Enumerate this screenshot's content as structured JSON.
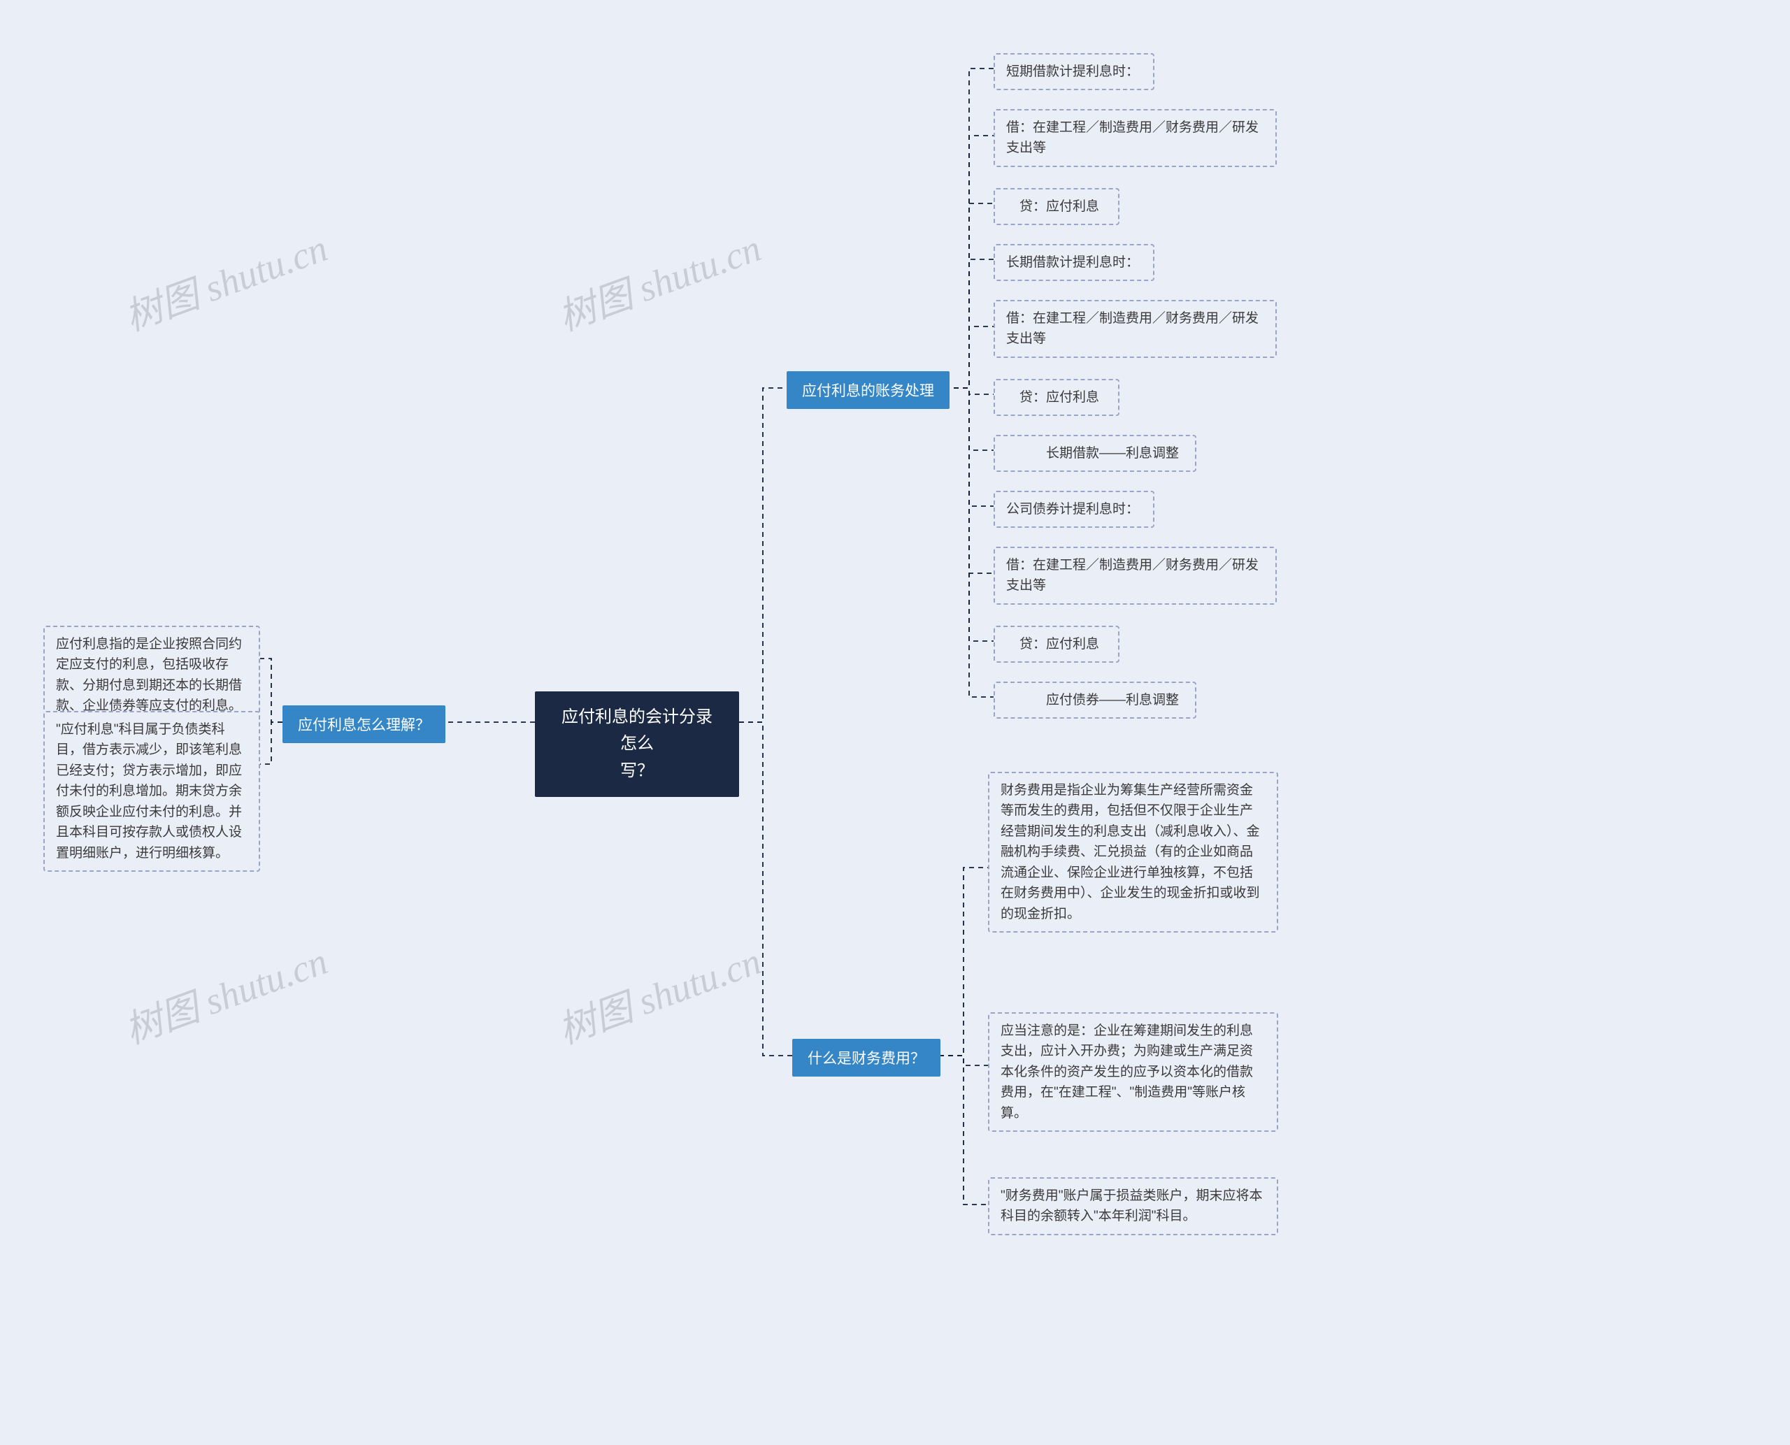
{
  "root": {
    "title": "应付利息的会计分录怎么\n写？"
  },
  "left_branch": {
    "title": "应付利息怎么理解？",
    "leaves": [
      "应付利息指的是企业按照合同约定应支付的利息，包括吸收存款、分期付息到期还本的长期借款、企业债券等应支付的利息。",
      "\"应付利息\"科目属于负债类科目，借方表示减少，即该笔利息已经支付；贷方表示增加，即应付未付的利息增加。期末贷方余额反映企业应付未付的利息。并且本科目可按存款人或债权人设置明细账户，进行明细核算。"
    ]
  },
  "right_branch1": {
    "title": "应付利息的账务处理",
    "leaves": [
      "短期借款计提利息时：",
      "借：在建工程／制造费用／财务费用／研发支出等",
      "　贷：应付利息",
      "长期借款计提利息时：",
      "借：在建工程／制造费用／财务费用／研发支出等",
      "　贷：应付利息",
      "　　　长期借款——利息调整",
      "公司债券计提利息时：",
      "借：在建工程／制造费用／财务费用／研发支出等",
      "　贷：应付利息",
      "　　　应付债券——利息调整"
    ]
  },
  "right_branch2": {
    "title": "什么是财务费用？",
    "leaves": [
      "财务费用是指企业为筹集生产经营所需资金等而发生的费用，包括但不仅限于企业生产经营期间发生的利息支出（减利息收入）、金融机构手续费、汇兑损益（有的企业如商品流通企业、保险企业进行单独核算，不包括在财务费用中）、企业发生的现金折扣或收到的现金折扣。",
      "应当注意的是：企业在筹建期间发生的利息支出，应计入开办费；为购建或生产满足资本化条件的资产发生的应予以资本化的借款费用，在\"在建工程\"、\"制造费用\"等账户核算。",
      "\"财务费用\"账户属于损益类账户，期末应将本科目的余额转入\"本年利润\"科目。"
    ]
  },
  "watermarks": [
    "树图 shutu.cn",
    "树图 shutu.cn",
    "树图 shutu.cn",
    "树图 shutu.cn"
  ]
}
